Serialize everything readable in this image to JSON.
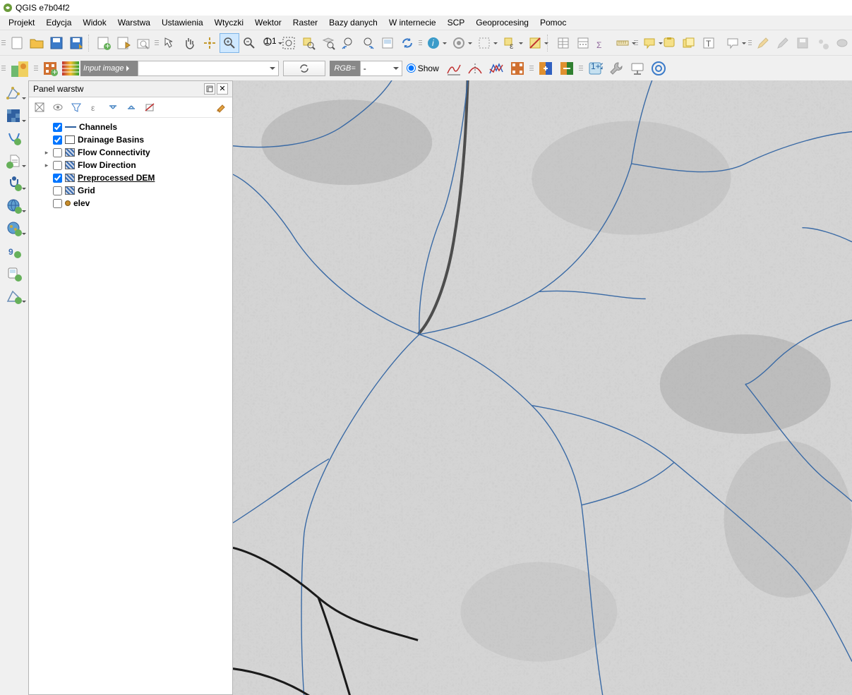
{
  "title": "QGIS e7b04f2",
  "menu": [
    "Projekt",
    "Edycja",
    "Widok",
    "Warstwa",
    "Ustawienia",
    "Wtyczki",
    "Wektor",
    "Raster",
    "Bazy danych",
    "W internecie",
    "SCP",
    "Geoprocesing",
    "Pomoc"
  ],
  "scp": {
    "input_image_label": "Input image",
    "rgb_label": "RGB=",
    "rgb_value": "-",
    "show_label": "Show"
  },
  "layers_panel": {
    "title": "Panel warstw",
    "layers": [
      {
        "name": "Channels",
        "checked": true,
        "symbol": "line",
        "expandable": false
      },
      {
        "name": "Drainage Basins",
        "checked": true,
        "symbol": "box",
        "expandable": false
      },
      {
        "name": "Flow Connectivity",
        "checked": false,
        "symbol": "rast",
        "expandable": true
      },
      {
        "name": "Flow Direction",
        "checked": false,
        "symbol": "rast",
        "expandable": true
      },
      {
        "name": "Preprocessed DEM",
        "checked": true,
        "symbol": "rast",
        "expandable": false,
        "underline": true
      },
      {
        "name": "Grid",
        "checked": false,
        "symbol": "rast",
        "expandable": false
      },
      {
        "name": "elev",
        "checked": false,
        "symbol": "point",
        "expandable": false
      }
    ]
  }
}
